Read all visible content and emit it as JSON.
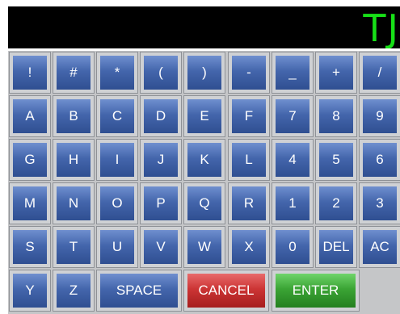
{
  "display": {
    "text": "TJ"
  },
  "colors": {
    "display_bg": "#000000",
    "display_text": "#17e017",
    "key_blue": "#4466ac",
    "key_red": "#cc3535",
    "key_green": "#3ba435",
    "frame": "#c5c6c8"
  },
  "keypad": {
    "rows": [
      [
        {
          "label": "!",
          "name": "key-exclamation"
        },
        {
          "label": "#",
          "name": "key-hash"
        },
        {
          "label": "*",
          "name": "key-asterisk"
        },
        {
          "label": "(",
          "name": "key-open-paren"
        },
        {
          "label": ")",
          "name": "key-close-paren"
        },
        {
          "label": "-",
          "name": "key-minus"
        },
        {
          "label": "_",
          "name": "key-underscore"
        },
        {
          "label": "+",
          "name": "key-plus"
        },
        {
          "label": "/",
          "name": "key-slash"
        }
      ],
      [
        {
          "label": "A",
          "name": "key-a"
        },
        {
          "label": "B",
          "name": "key-b"
        },
        {
          "label": "C",
          "name": "key-c"
        },
        {
          "label": "D",
          "name": "key-d"
        },
        {
          "label": "E",
          "name": "key-e"
        },
        {
          "label": "F",
          "name": "key-f"
        },
        {
          "label": "7",
          "name": "key-7"
        },
        {
          "label": "8",
          "name": "key-8"
        },
        {
          "label": "9",
          "name": "key-9"
        }
      ],
      [
        {
          "label": "G",
          "name": "key-g"
        },
        {
          "label": "H",
          "name": "key-h"
        },
        {
          "label": "I",
          "name": "key-i"
        },
        {
          "label": "J",
          "name": "key-j"
        },
        {
          "label": "K",
          "name": "key-k"
        },
        {
          "label": "L",
          "name": "key-l"
        },
        {
          "label": "4",
          "name": "key-4"
        },
        {
          "label": "5",
          "name": "key-5"
        },
        {
          "label": "6",
          "name": "key-6"
        }
      ],
      [
        {
          "label": "M",
          "name": "key-m"
        },
        {
          "label": "N",
          "name": "key-n"
        },
        {
          "label": "O",
          "name": "key-o"
        },
        {
          "label": "P",
          "name": "key-p"
        },
        {
          "label": "Q",
          "name": "key-q"
        },
        {
          "label": "R",
          "name": "key-r"
        },
        {
          "label": "1",
          "name": "key-1"
        },
        {
          "label": "2",
          "name": "key-2"
        },
        {
          "label": "3",
          "name": "key-3"
        }
      ],
      [
        {
          "label": "S",
          "name": "key-s"
        },
        {
          "label": "T",
          "name": "key-t"
        },
        {
          "label": "U",
          "name": "key-u"
        },
        {
          "label": "V",
          "name": "key-v"
        },
        {
          "label": "W",
          "name": "key-w"
        },
        {
          "label": "X",
          "name": "key-x"
        },
        {
          "label": "0",
          "name": "key-0"
        },
        {
          "label": "DEL",
          "name": "delete-button"
        },
        {
          "label": "AC",
          "name": "all-clear-button"
        }
      ]
    ],
    "bottom_row": [
      {
        "label": "Y",
        "name": "key-y",
        "color": "blue"
      },
      {
        "label": "Z",
        "name": "key-z",
        "color": "blue"
      },
      {
        "label": "SPACE",
        "name": "space-button",
        "color": "blue"
      },
      {
        "label": "CANCEL",
        "name": "cancel-button",
        "color": "red"
      },
      {
        "label": "ENTER",
        "name": "enter-button",
        "color": "green"
      }
    ]
  }
}
